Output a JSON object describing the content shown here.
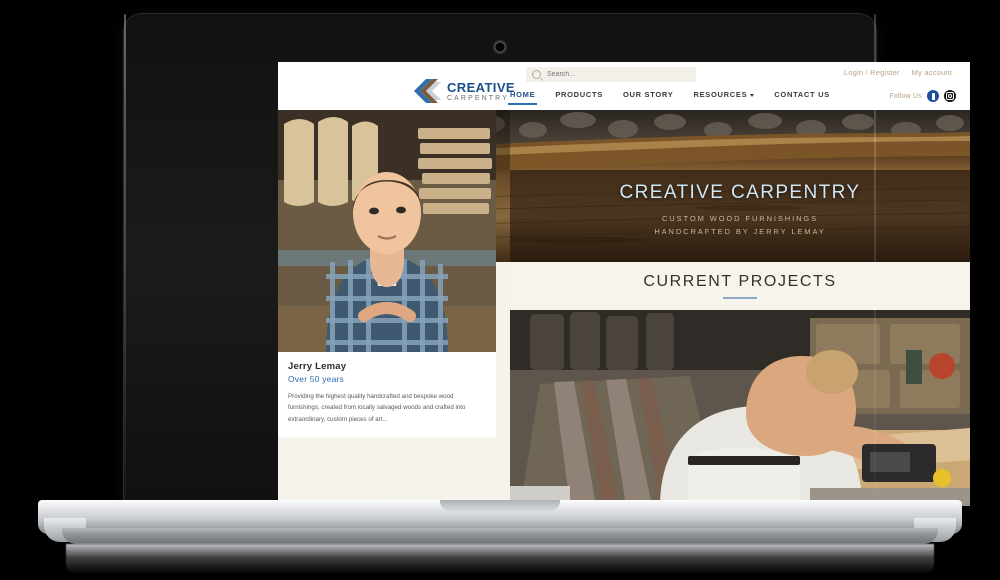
{
  "device": {
    "type": "laptop-mockup",
    "webcam": "webcam-dot"
  },
  "header": {
    "search": {
      "placeholder": "Search...",
      "value": "",
      "icon": "search-icon"
    },
    "account_links": [
      {
        "label": "Login / Register"
      },
      {
        "label": "My account"
      }
    ],
    "brand": {
      "line1": "CREATIVE",
      "line2": "CARPENTRY",
      "logo": "chevron-logo-icon"
    },
    "nav": [
      {
        "label": "HOME",
        "active": true
      },
      {
        "label": "PRODUCTS",
        "active": false
      },
      {
        "label": "OUR STORY",
        "active": false
      },
      {
        "label": "RESOURCES",
        "active": false,
        "caret": true
      },
      {
        "label": "CONTACT US",
        "active": false
      }
    ],
    "follow": {
      "label": "Follow Us",
      "socials": [
        {
          "name": "facebook-icon"
        },
        {
          "name": "instagram-icon"
        }
      ]
    }
  },
  "hero": {
    "title": "CREATIVE CARPENTRY",
    "subtitle_line1": "CUSTOM WOOD FURNISHINGS",
    "subtitle_line2": "HANDCRAFTED BY JERRY LEMAY",
    "background": "live-edge-wood-slab-photo"
  },
  "section": {
    "title": "CURRENT PROJECTS",
    "image": "craftsman-planing-wood-workshop-photo"
  },
  "profile": {
    "image": "jerry-lemay-portrait-photo",
    "name": "Jerry Lemay",
    "experience": "Over 50 years",
    "description": "Providing the highest quality handcrafted and bespoke wood furnishings, created from locally salvaged woods and crafted into extraordinary, custom pieces of art..."
  },
  "colors": {
    "brand_blue": "#1b4f8a",
    "accent_blue": "#2f6fb0",
    "gold": "#b8a183",
    "hero_title": "#cfe6f5",
    "hero_sub": "#cbb794",
    "page_bg": "#f7f4ee"
  }
}
